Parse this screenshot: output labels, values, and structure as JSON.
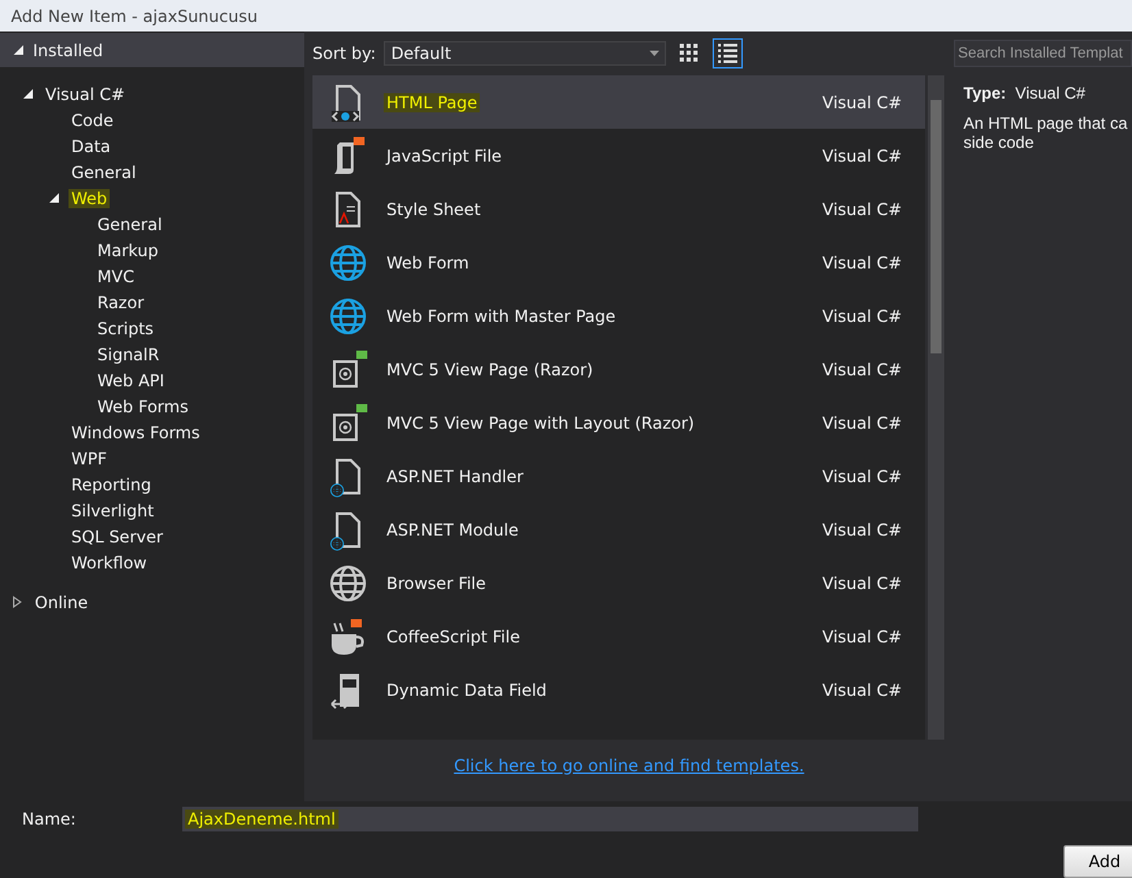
{
  "window": {
    "title": "Add New Item - ajaxSunucusu"
  },
  "sidebar": {
    "sections": [
      {
        "label": "Installed",
        "expanded": true,
        "children": [
          {
            "label": "Visual C#",
            "expanded": true,
            "highlighted": false,
            "children": [
              {
                "label": "Code",
                "highlighted": false
              },
              {
                "label": "Data",
                "highlighted": false
              },
              {
                "label": "General",
                "highlighted": false
              },
              {
                "label": "Web",
                "expanded": true,
                "highlighted": true,
                "children": [
                  {
                    "label": "General",
                    "highlighted": false
                  },
                  {
                    "label": "Markup",
                    "highlighted": false
                  },
                  {
                    "label": "MVC",
                    "highlighted": false
                  },
                  {
                    "label": "Razor",
                    "highlighted": false
                  },
                  {
                    "label": "Scripts",
                    "highlighted": false
                  },
                  {
                    "label": "SignalR",
                    "highlighted": false
                  },
                  {
                    "label": "Web API",
                    "highlighted": false
                  },
                  {
                    "label": "Web Forms",
                    "highlighted": false
                  }
                ]
              },
              {
                "label": "Windows Forms",
                "highlighted": false
              },
              {
                "label": "WPF",
                "highlighted": false
              },
              {
                "label": "Reporting",
                "highlighted": false
              },
              {
                "label": "Silverlight",
                "highlighted": false
              },
              {
                "label": "SQL Server",
                "highlighted": false
              },
              {
                "label": "Workflow",
                "highlighted": false
              }
            ]
          }
        ]
      },
      {
        "label": "Online",
        "expanded": false
      }
    ]
  },
  "toolbar": {
    "sort_label": "Sort by:",
    "sort_value": "Default",
    "views": [
      {
        "kind": "grid",
        "selected": false
      },
      {
        "kind": "list",
        "selected": true
      }
    ]
  },
  "search": {
    "placeholder": "Search Installed Templat"
  },
  "templates": [
    {
      "kind": "html",
      "name": "HTML Page",
      "language": "Visual C#",
      "selected": true,
      "highlighted": true
    },
    {
      "kind": "js",
      "name": "JavaScript File",
      "language": "Visual C#",
      "selected": false,
      "highlighted": false
    },
    {
      "kind": "css",
      "name": "Style Sheet",
      "language": "Visual C#",
      "selected": false,
      "highlighted": false
    },
    {
      "kind": "globe",
      "name": "Web Form",
      "language": "Visual C#",
      "selected": false,
      "highlighted": false
    },
    {
      "kind": "globe",
      "name": "Web Form with Master Page",
      "language": "Visual C#",
      "selected": false,
      "highlighted": false
    },
    {
      "kind": "razor",
      "name": "MVC 5 View Page (Razor)",
      "language": "Visual C#",
      "selected": false,
      "highlighted": false
    },
    {
      "kind": "razor",
      "name": "MVC 5 View Page with Layout (Razor)",
      "language": "Visual C#",
      "selected": false,
      "highlighted": false
    },
    {
      "kind": "aspnet",
      "name": "ASP.NET Handler",
      "language": "Visual C#",
      "selected": false,
      "highlighted": false
    },
    {
      "kind": "aspnet",
      "name": "ASP.NET Module",
      "language": "Visual C#",
      "selected": false,
      "highlighted": false
    },
    {
      "kind": "browser",
      "name": "Browser File",
      "language": "Visual C#",
      "selected": false,
      "highlighted": false
    },
    {
      "kind": "coffee",
      "name": "CoffeeScript File",
      "language": "Visual C#",
      "selected": false,
      "highlighted": false
    },
    {
      "kind": "field",
      "name": "Dynamic Data Field",
      "language": "Visual C#",
      "selected": false,
      "highlighted": false
    }
  ],
  "details": {
    "type_label": "Type:",
    "type_value": "Visual C#",
    "description": "An HTML page that ca\nside code"
  },
  "online_link": "Click here to go online and find templates.",
  "name_field": {
    "label": "Name:",
    "value": "AjaxDeneme.html",
    "highlighted": true
  },
  "buttons": [
    "Add"
  ]
}
